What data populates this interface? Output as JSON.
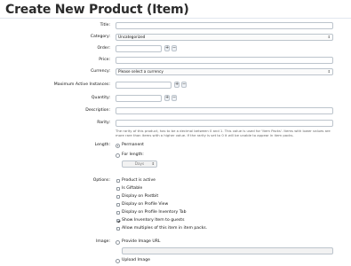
{
  "page": {
    "title": "Create New Product (Item)"
  },
  "form": {
    "title_label": "Title:",
    "category_label": "Category:",
    "category_value": "Uncategorized",
    "order_label": "Order:",
    "price_label": "Price:",
    "currency_label": "Currency:",
    "currency_value": "Please select a currency",
    "max_active_label": "Maximum Active Instances:",
    "quantity_label": "Quantity:",
    "description_label": "Description:",
    "rarity_label": "Rarity:",
    "rarity_help": "The rarity of this product, has to be a decimal between 0 and 1. This value is used for 'Item Packs'. Items with lower values are more rare than items with a higher value. If the rarity is set to 0 it will be unable to appear in item packs.",
    "length_label": "Length:",
    "length_options": [
      "Permanent",
      "For length:"
    ],
    "length_unit_value": "Days",
    "options_label": "Options:",
    "options": [
      "Product is active",
      "Is Giftable",
      "Display on Postbit",
      "Display on Profile View",
      "Display on Profile Inventory Tab",
      "Show Inventory Item to guests",
      "Allow multiples of this item in item packs."
    ],
    "image_label": "Image:",
    "image_options": [
      "Provide Image URL",
      "Upload Image"
    ]
  },
  "icons": {
    "stepper_up": "+",
    "stepper_down": "−",
    "select_caret": "⇕"
  }
}
